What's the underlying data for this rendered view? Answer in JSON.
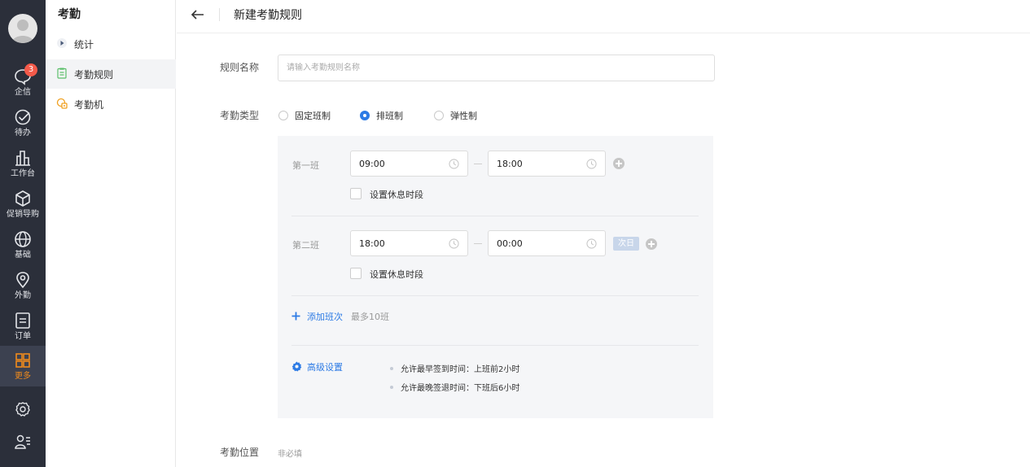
{
  "rail": {
    "badge": "3",
    "items": [
      {
        "label": "企信"
      },
      {
        "label": "待办"
      },
      {
        "label": "工作台"
      },
      {
        "label": "促销导购"
      },
      {
        "label": "基础"
      },
      {
        "label": "外勤"
      },
      {
        "label": "订单"
      },
      {
        "label": "更多"
      }
    ]
  },
  "submenu": {
    "title": "考勤",
    "items": [
      {
        "label": "统计"
      },
      {
        "label": "考勤规则"
      },
      {
        "label": "考勤机"
      }
    ]
  },
  "header": {
    "title": "新建考勤规则"
  },
  "form": {
    "rule_name_label": "规则名称",
    "rule_name_placeholder": "请输入考勤规则名称",
    "type_label": "考勤类型",
    "types": [
      "固定班制",
      "排班制",
      "弹性制"
    ],
    "selected_type": "排班制",
    "shifts": [
      {
        "label": "第一班",
        "start": "09:00",
        "end": "18:00",
        "break_text": "设置休息时段"
      },
      {
        "label": "第二班",
        "start": "18:00",
        "end": "00:00",
        "next_day": "次日",
        "break_text": "设置休息时段"
      }
    ],
    "add_shift": "添加班次",
    "max_shifts": "最多10班",
    "advanced": "高级设置",
    "rules": [
      "允许最早签到时间：上班前2小时",
      "允许最晚签退时间：下班后6小时"
    ],
    "location_label": "考勤位置",
    "location_optional": "非必填"
  },
  "colors": {
    "rail_bg": "#2b2f3a",
    "accent_blue": "#2d7be5",
    "active_orange": "#f08a1c",
    "badge_red": "#f45a4a"
  },
  "icons": {
    "rail": [
      "chat-icon",
      "check-circle-icon",
      "workbench-icon",
      "box-icon",
      "globe-icon",
      "location-pin-icon",
      "order-icon",
      "grid-icon",
      "settings-icon",
      "user-list-icon"
    ],
    "submenu": [
      "triangle-right-icon",
      "clipboard-icon",
      "device-icon"
    ]
  }
}
